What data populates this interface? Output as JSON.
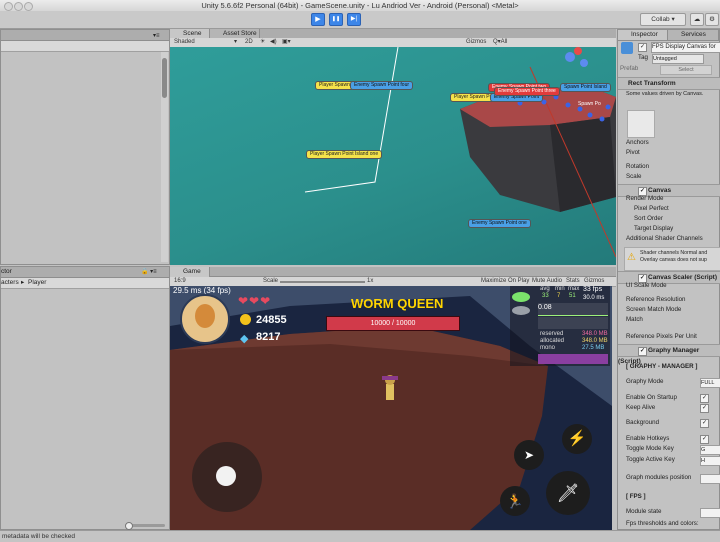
{
  "window": {
    "title": "Unity 5.6.6f2 Personal (64bit) - GameScene.unity - Lu Andriod Ver - Android (Personal) <Metal>"
  },
  "toolbar": {
    "play": "▶",
    "pause": "❚❚",
    "step": "▶|",
    "collab": "Collab ▾"
  },
  "scene_tab": {
    "tabs": [
      "Scene",
      "Asset Store"
    ],
    "shading": "Shaded",
    "mode_2d": "2D",
    "gizmos": "Gizmos",
    "search": "Q▾All",
    "labels": {
      "spawn_four": "Player Spawn",
      "enemy_four": "Enemy Spawn Point four",
      "spawn_island_one": "Player Spawn Point Island one",
      "enemy_one": "Enemy Spawn Point one",
      "spawn_mid": "Player Spawn Point",
      "enemy_mid": "Enemy Spawn Point",
      "red_a": "Enemy Spawn Point two",
      "red_b": "Enemy Spawn Point three",
      "island_small": "Spawn Point Island",
      "spawn_s": "Spawn Po"
    }
  },
  "hierarchy": {
    "lower_tab": "ctor",
    "col1": "acters",
    "col2": "Player"
  },
  "game_tab": {
    "tab": "Game",
    "aspect": "16:9",
    "scale_label": "Scale",
    "scale_value": "1x",
    "options": [
      "Maximize On Play",
      "Mute Audio",
      "Stats",
      "Gizmos"
    ],
    "fps_ms": "29.5 ms (34 fps)",
    "coins": "24855",
    "gems": "8217",
    "boss_name": "WORM QUEEN",
    "boss_hp": "10000 / 10000",
    "boss_hp_fraction": 1.0,
    "fps_graph": {
      "headers": [
        "avg",
        "min",
        "max"
      ],
      "values": [
        "33",
        "7",
        "51"
      ],
      "fps": "33 fps",
      "ms": "30.0 ms",
      "value_08": "0.08"
    },
    "memory": {
      "reserved_label": "reserved",
      "reserved": "348.0 MB",
      "allocated_label": "allocated",
      "allocated": "348.0 MB",
      "mono_label": "mono",
      "mono": "27.5 MB"
    }
  },
  "status_bar": {
    "text": "metadata will be checked"
  },
  "inspector": {
    "tabs": [
      "Inspector",
      "Services"
    ],
    "object_name": "FPS Display Canvas for",
    "tag_label": "Tag",
    "tag_value": "Untagged",
    "prefab_label": "Prefab",
    "prefab_select": "Select",
    "rect_transform": "Rect Transform",
    "rect_note": "Some values driven by Canvas.",
    "anchors": "Anchors",
    "pivot": "Pivot",
    "rotation": "Rotation",
    "scale": "Scale",
    "canvas": "Canvas",
    "render_mode": "Render Mode",
    "pixel_perfect": "Pixel Perfect",
    "sort_order": "Sort Order",
    "target_display": "Target Display",
    "additional_channels": "Additional Shader Channels",
    "warning": "Shader channels Normal and Overlay canvas does not sup",
    "canvas_scaler": "Canvas Scaler (Script)",
    "ui_scale_mode": "UI Scale Mode",
    "ref_resolution": "Reference Resolution",
    "screen_match_mode": "Screen Match Mode",
    "match": "Match",
    "ref_ppu": "Reference Pixels Per Unit",
    "graphy_manager": "Graphy Manager (Script)",
    "graphy_header": "[ GRAPHY - MANAGER ]",
    "graphy_mode": "Graphy Mode",
    "graphy_mode_value": "FULL",
    "enable_on_startup": "Enable On Startup",
    "keep_alive": "Keep Alive",
    "background": "Background",
    "enable_hotkeys": "Enable Hotkeys",
    "toggle_mode_key": "Toggle Mode Key",
    "toggle_mode_key_value": "G",
    "toggle_active_key": "Toggle Active Key",
    "toggle_active_key_value": "H",
    "graph_modules_position": "Graph modules position",
    "fps_header": "[ FPS ]",
    "module_state": "Module state",
    "fps_thresholds": "Fps thresholds and colors:"
  },
  "colors": {
    "accent": "#3d86e8",
    "scene_water": "#2b8f8c",
    "ground": "#5a2d26",
    "boss_red": "#d13a4a",
    "boss_title": "#ffd400"
  }
}
